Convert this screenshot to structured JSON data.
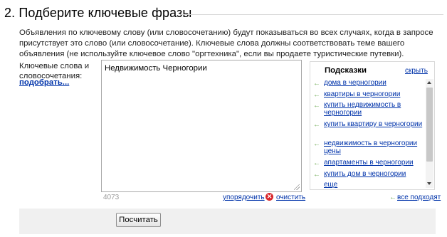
{
  "section": {
    "title": "2. Подберите ключевые фразы",
    "description": "Объявления по ключевому слову (или словосочетанию) будут показываться во всех случаях, когда в запросе присутствует это слово (или словосочетание). Ключевые слова должны соответствовать теме вашего объявления (не используйте ключевое слово \"оргтехника\", если вы продаете туристические путевки)."
  },
  "keywords": {
    "label": "Ключевые слова и словосочетания:",
    "pick_link": "подобрать...",
    "value": "Недвижимость Черногории",
    "count": "4073",
    "sort_link": "упорядочить",
    "clear_link": "очистить"
  },
  "hints": {
    "title": "Подсказки",
    "hide_link": "скрыть",
    "items": [
      "дома в черногории",
      "квартиры в черногории",
      "купить недвижимость в черногории",
      "купить квартиру в черногории",
      "недвижимость в черногории цены",
      "апартаменты в черногории",
      "купить дом в черногории",
      "еще"
    ],
    "all_fit_link": "все подходят"
  },
  "actions": {
    "calculate_label": "Посчитать"
  },
  "colors": {
    "link": "#0033aa",
    "arrow": "#6aa84f",
    "clear_icon": "#d8262b"
  }
}
